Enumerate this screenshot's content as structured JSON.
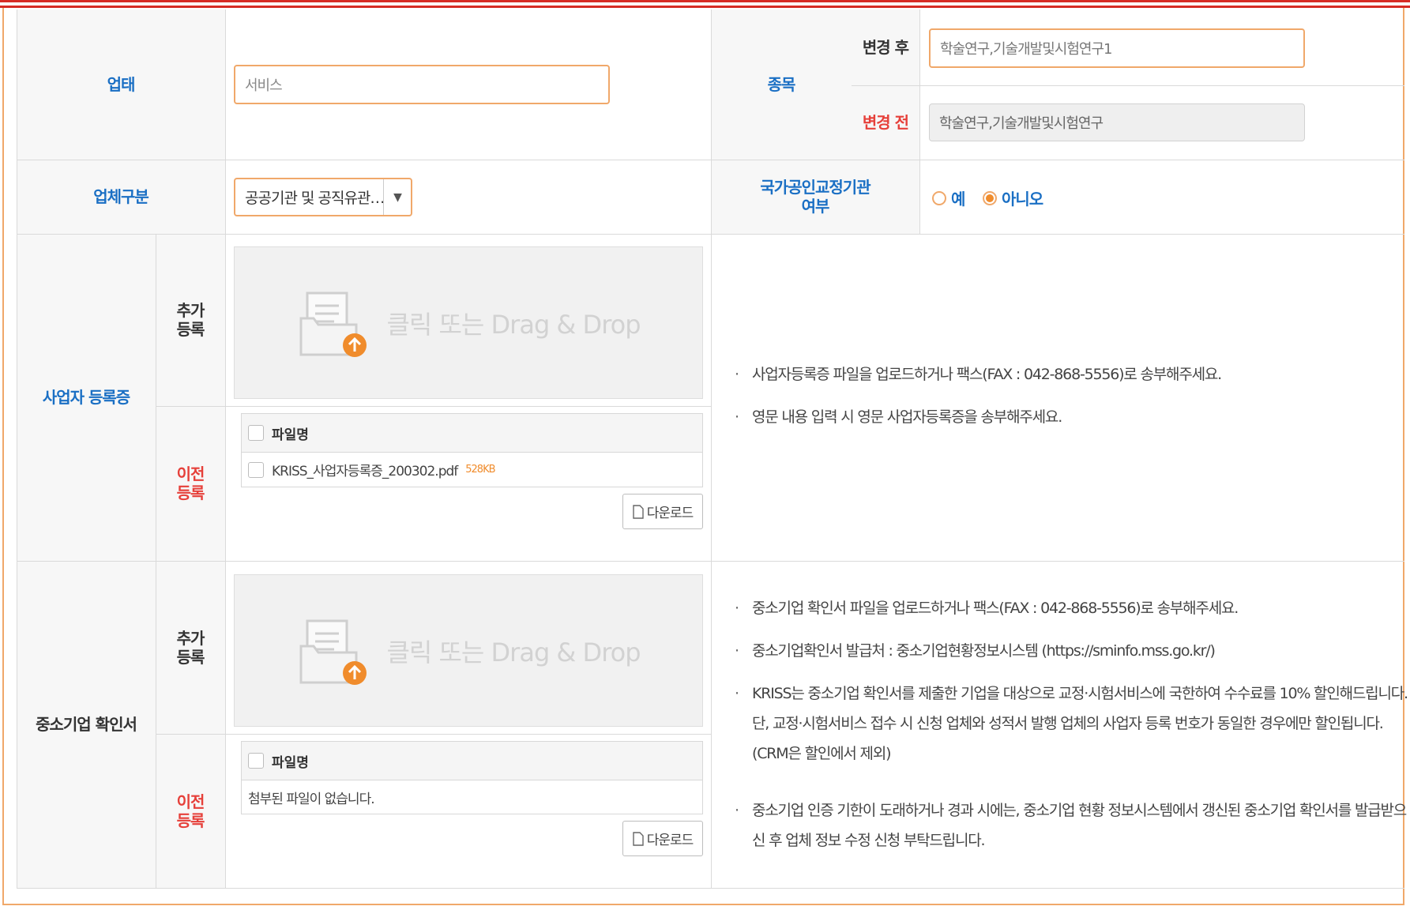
{
  "row1": {
    "industry_label": "업태",
    "industry_value": "서비스",
    "item_label": "종목",
    "after_label": "변경 후",
    "after_value": "학술연구,기술개발및시험연구1",
    "before_label": "변경 전",
    "before_value": "학술연구,기술개발및시험연구"
  },
  "row2": {
    "company_type_label": "업체구분",
    "company_type_value": "공공기관 및 공직유관…",
    "national_label_line1": "국가공인교정기관",
    "national_label_line2": "여부",
    "radio_yes": "예",
    "radio_no": "아니오",
    "selected": "no"
  },
  "business_reg": {
    "label": "사업자 등록증",
    "add_label_line1": "추가",
    "add_label_line2": "등록",
    "prev_label_line1": "이전",
    "prev_label_line2": "등록",
    "drop_text": "클릭 또는 Drag & Drop",
    "file_header": "파일명",
    "file_name": "KRISS_사업자등록증_200302.pdf",
    "file_size": "528KB",
    "download": "다운로드",
    "notes": [
      "사업자등록증 파일을 업로드하거나 팩스(FAX : 042-868-5556)로 송부해주세요.",
      "영문 내용 입력 시 영문 사업자등록증을 송부해주세요."
    ]
  },
  "sme": {
    "label": "중소기업 확인서",
    "add_label_line1": "추가",
    "add_label_line2": "등록",
    "prev_label_line1": "이전",
    "prev_label_line2": "등록",
    "drop_text": "클릭 또는 Drag & Drop",
    "file_header": "파일명",
    "empty_text": "첨부된 파일이 없습니다.",
    "download": "다운로드",
    "note1": "중소기업 확인서 파일을 업로드하거나 팩스(FAX : 042-868-5556)로 송부해주세요.",
    "note2": "중소기업확인서 발급처 : 중소기업현황정보시스템 (https://sminfo.mss.go.kr/)",
    "note3_line1": "KRISS는 중소기업 확인서를 제출한 기업을 대상으로 교정·시험서비스에 국한하여 수수료를 10% 할인해드립니다.",
    "note3_line2": "단, 교정·시험서비스 접수 시 신청 업체와 성적서 발행 업체의 사업자 등록 번호가 동일한 경우에만 할인됩니다.",
    "note3_line3": "(CRM은 할인에서 제외)",
    "note4_line1": "중소기업 인증 기한이 도래하거나 경과 시에는, 중소기업 현황 정보시스템에서 갱신된 중소기업 확인서를 발급받으",
    "note4_line2": "신 후 업체 정보 수정 신청 부탁드립니다."
  },
  "colors": {
    "accent_orange": "#f0a86a",
    "label_blue": "#1a6fc4",
    "label_red": "#e6403a",
    "top_red": "#d62c25"
  }
}
